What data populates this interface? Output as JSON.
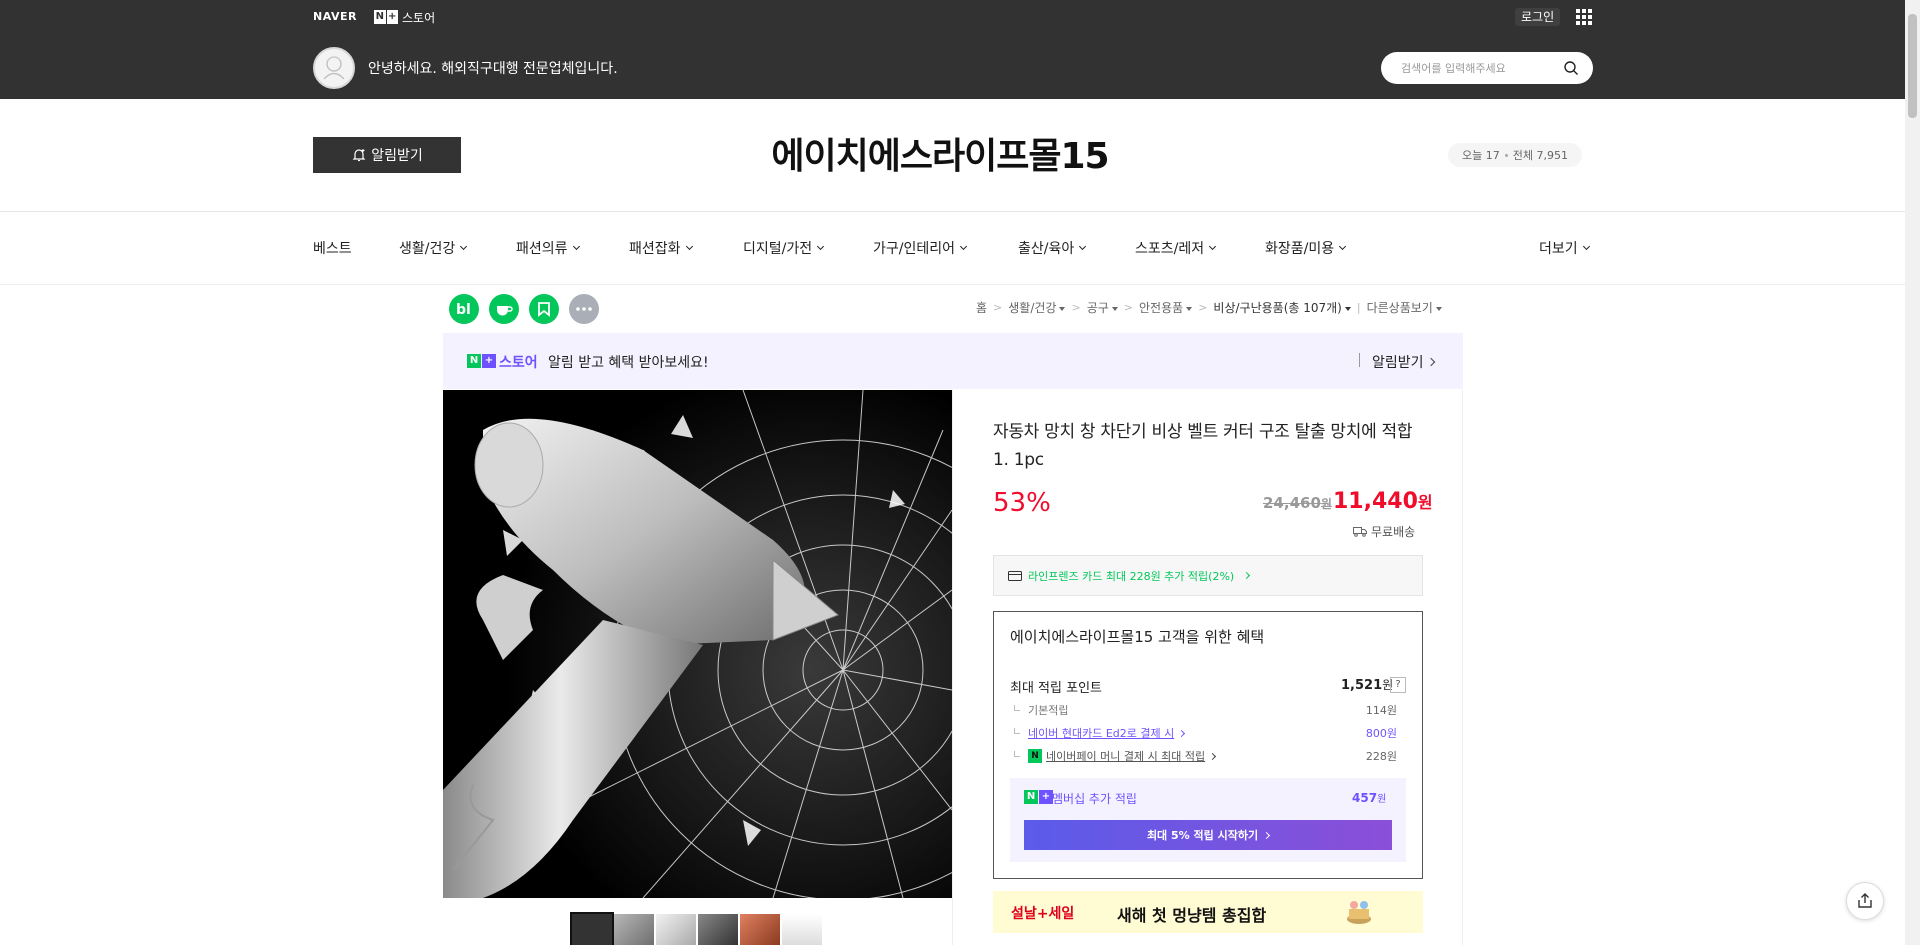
{
  "global_header": {
    "naver_label": "NAVER",
    "nplus_badge": "N",
    "nplus_plus": "+",
    "store_label": "스토어",
    "login_label": "로그인",
    "greeting": "안녕하세요. 해외직구대행 전문업체입니다.",
    "search_placeholder": "검색어를 입력해주세요"
  },
  "store_header": {
    "alarm_button": "알림받기",
    "store_name": "에이치에스라이프몰15",
    "visitors_today": "오늘 17",
    "visitors_total": "전체 7,951"
  },
  "nav": {
    "items": [
      {
        "label": "베스트",
        "dropdown": false
      },
      {
        "label": "생활/건강",
        "dropdown": true
      },
      {
        "label": "패션의류",
        "dropdown": true
      },
      {
        "label": "패션잡화",
        "dropdown": true
      },
      {
        "label": "디지털/가전",
        "dropdown": true
      },
      {
        "label": "가구/인테리어",
        "dropdown": true
      },
      {
        "label": "출산/육아",
        "dropdown": true
      },
      {
        "label": "스포츠/레저",
        "dropdown": true
      },
      {
        "label": "화장품/미용",
        "dropdown": true
      }
    ],
    "more_label": "더보기"
  },
  "share_icons": [
    "blog-icon",
    "cafe-icon",
    "bookmark-icon",
    "more-icon"
  ],
  "breadcrumb": {
    "home": "홈",
    "levels": [
      "생활/건강",
      "공구",
      "안전용품"
    ],
    "current": "비상/구난용품(총 107개)",
    "other": "다른상품보기"
  },
  "promo": {
    "badge_n": "N",
    "badge_plus": "+",
    "store": "스토어",
    "text": "알림 받고 혜택 받아보세요!",
    "alarm_label": "알림받기"
  },
  "product": {
    "title": "자동차 망치 창 차단기 비상 벨트 커터 구조 탈출 망치에 적합 1. 1pc",
    "discount": "53%",
    "original_price": "24,460",
    "price": "11,440",
    "won": "원",
    "shipping": "무료배송",
    "card_offer": "라인프렌즈 카드 최대 228원 추가 적립(2%)"
  },
  "benefit": {
    "title": "에이치에스라이프몰15 고객을 위한 혜택",
    "max_point_label": "최대 적립 포인트",
    "max_point_value": "1,521",
    "help_icon_label": "?",
    "rows": [
      {
        "label": "기본적립",
        "value": "114원"
      },
      {
        "label": "네이버 현대카드 Ed2로 결제 시",
        "value": "800원"
      },
      {
        "label": "네이버페이 머니 결제 시 최대 적립",
        "value": "228원"
      }
    ],
    "npay_badge": "N",
    "membership_label": "멤버십 추가 적립",
    "membership_value": "457",
    "membership_button": "최대 5% 적립 시작하기"
  },
  "sale_banner": {
    "label": "설날+세일",
    "text": "새해 첫 멍냥템 총집합"
  },
  "colors": {
    "header_bg": "#323232",
    "discount_red": "#ef0d2b",
    "naver_green": "#03c75a",
    "plus_purple": "#6e52ff"
  }
}
